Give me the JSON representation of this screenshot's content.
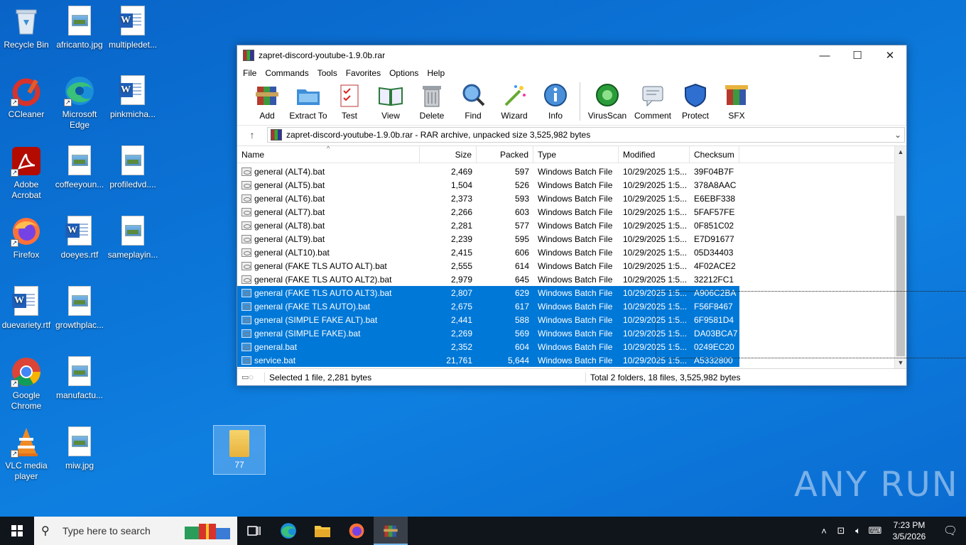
{
  "desktop": {
    "icons_col1": [
      {
        "label": "Recycle Bin",
        "icon": "recycle-bin-icon"
      },
      {
        "label": "CCleaner",
        "icon": "ccleaner-icon"
      },
      {
        "label": "Adobe Acrobat",
        "icon": "adobe-acrobat-icon"
      },
      {
        "label": "Firefox",
        "icon": "firefox-icon"
      },
      {
        "label": "duevariety.rtf",
        "icon": "word-doc-icon"
      },
      {
        "label": "Google Chrome",
        "icon": "chrome-icon"
      },
      {
        "label": "VLC media player",
        "icon": "vlc-icon"
      }
    ],
    "icons_col2": [
      {
        "label": "africanto.jpg",
        "icon": "image-file-icon"
      },
      {
        "label": "Microsoft Edge",
        "icon": "edge-icon"
      },
      {
        "label": "coffeeyoun...",
        "icon": "image-file-icon"
      },
      {
        "label": "doeyes.rtf",
        "icon": "word-doc-icon"
      },
      {
        "label": "growthplac...",
        "icon": "image-file-icon"
      },
      {
        "label": "manufactu...",
        "icon": "image-file-icon"
      },
      {
        "label": "miw.jpg",
        "icon": "image-file-icon"
      }
    ],
    "icons_col3": [
      {
        "label": "multipledet...",
        "icon": "word-doc-icon"
      },
      {
        "label": "pinkmicha...",
        "icon": "word-doc-icon"
      },
      {
        "label": "profiledvd....",
        "icon": "image-file-icon"
      },
      {
        "label": "sameplayin...",
        "icon": "image-file-icon"
      }
    ],
    "selected_folder": {
      "label": "77"
    },
    "watermark": "ANY RUN"
  },
  "window": {
    "title": "zapret-discord-youtube-1.9.0b.rar",
    "menu": [
      "File",
      "Commands",
      "Tools",
      "Favorites",
      "Options",
      "Help"
    ],
    "toolbar": [
      {
        "label": "Add",
        "icon": "add-icon"
      },
      {
        "label": "Extract To",
        "icon": "extract-folder-icon"
      },
      {
        "label": "Test",
        "icon": "test-checklist-icon"
      },
      {
        "label": "View",
        "icon": "view-book-icon"
      },
      {
        "label": "Delete",
        "icon": "trash-icon"
      },
      {
        "label": "Find",
        "icon": "magnifier-icon"
      },
      {
        "label": "Wizard",
        "icon": "wizard-wand-icon"
      },
      {
        "label": "Info",
        "icon": "info-icon"
      }
    ],
    "toolbar2": [
      {
        "label": "VirusScan",
        "icon": "virus-icon"
      },
      {
        "label": "Comment",
        "icon": "comment-icon"
      },
      {
        "label": "Protect",
        "icon": "shield-icon"
      },
      {
        "label": "SFX",
        "icon": "sfx-books-icon"
      }
    ],
    "address": "zapret-discord-youtube-1.9.0b.rar - RAR archive, unpacked size 3,525,982 bytes",
    "columns": {
      "name": "Name",
      "size": "Size",
      "packed": "Packed",
      "type": "Type",
      "modified": "Modified",
      "checksum": "Checksum"
    },
    "files": [
      {
        "name": "general (ALT4).bat",
        "size": "2,469",
        "packed": "597",
        "type": "Windows Batch File",
        "modified": "10/29/2025 1:5...",
        "checksum": "39F04B7F",
        "selected": false
      },
      {
        "name": "general (ALT5).bat",
        "size": "1,504",
        "packed": "526",
        "type": "Windows Batch File",
        "modified": "10/29/2025 1:5...",
        "checksum": "378A8AAC",
        "selected": false
      },
      {
        "name": "general (ALT6).bat",
        "size": "2,373",
        "packed": "593",
        "type": "Windows Batch File",
        "modified": "10/29/2025 1:5...",
        "checksum": "E6EBF338",
        "selected": false
      },
      {
        "name": "general (ALT7).bat",
        "size": "2,266",
        "packed": "603",
        "type": "Windows Batch File",
        "modified": "10/29/2025 1:5...",
        "checksum": "5FAF57FE",
        "selected": false
      },
      {
        "name": "general (ALT8).bat",
        "size": "2,281",
        "packed": "577",
        "type": "Windows Batch File",
        "modified": "10/29/2025 1:5...",
        "checksum": "0F851C02",
        "selected": false
      },
      {
        "name": "general (ALT9).bat",
        "size": "2,239",
        "packed": "595",
        "type": "Windows Batch File",
        "modified": "10/29/2025 1:5...",
        "checksum": "E7D91677",
        "selected": false
      },
      {
        "name": "general (ALT10).bat",
        "size": "2,415",
        "packed": "606",
        "type": "Windows Batch File",
        "modified": "10/29/2025 1:5...",
        "checksum": "05D34403",
        "selected": false
      },
      {
        "name": "general (FAKE TLS AUTO ALT).bat",
        "size": "2,555",
        "packed": "614",
        "type": "Windows Batch File",
        "modified": "10/29/2025 1:5...",
        "checksum": "4F02ACE2",
        "selected": false
      },
      {
        "name": "general (FAKE TLS AUTO ALT2).bat",
        "size": "2,979",
        "packed": "645",
        "type": "Windows Batch File",
        "modified": "10/29/2025 1:5...",
        "checksum": "32212FC1",
        "selected": false
      },
      {
        "name": "general (FAKE TLS AUTO ALT3).bat",
        "size": "2,807",
        "packed": "629",
        "type": "Windows Batch File",
        "modified": "10/29/2025 1:5...",
        "checksum": "A906C2BA",
        "selected": true
      },
      {
        "name": "general (FAKE TLS AUTO).bat",
        "size": "2,675",
        "packed": "617",
        "type": "Windows Batch File",
        "modified": "10/29/2025 1:5...",
        "checksum": "F56F8467",
        "selected": true
      },
      {
        "name": "general (SIMPLE FAKE ALT).bat",
        "size": "2,441",
        "packed": "588",
        "type": "Windows Batch File",
        "modified": "10/29/2025 1:5...",
        "checksum": "6F9581D4",
        "selected": true
      },
      {
        "name": "general (SIMPLE FAKE).bat",
        "size": "2,269",
        "packed": "569",
        "type": "Windows Batch File",
        "modified": "10/29/2025 1:5...",
        "checksum": "DA03BCA7",
        "selected": true
      },
      {
        "name": "general.bat",
        "size": "2,352",
        "packed": "604",
        "type": "Windows Batch File",
        "modified": "10/29/2025 1:5...",
        "checksum": "0249EC20",
        "selected": true
      },
      {
        "name": "service.bat",
        "size": "21,761",
        "packed": "5,644",
        "type": "Windows Batch File",
        "modified": "10/29/2025 1:5...",
        "checksum": "A5332800",
        "selected": true
      }
    ],
    "status_left": "Selected 1 file, 2,281 bytes",
    "status_right": "Total 2 folders, 18 files, 3,525,982 bytes"
  },
  "taskbar": {
    "search_placeholder": "Type here to search",
    "time": "7:23 PM",
    "date": "3/5/2026"
  },
  "colors": {
    "selection": "#0078d7",
    "taskbar": "#10151c",
    "desktop": "#0b74d6"
  }
}
